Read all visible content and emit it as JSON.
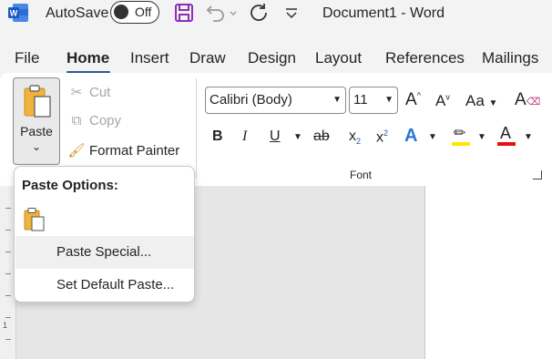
{
  "titlebar": {
    "autosave_label": "AutoSave",
    "autosave_state": "Off",
    "document_title": "Document1  -  Word"
  },
  "tabs": [
    "File",
    "Home",
    "Insert",
    "Draw",
    "Design",
    "Layout",
    "References",
    "Mailings"
  ],
  "active_tab": "Home",
  "clipboard": {
    "paste_label": "Paste",
    "cut_label": "Cut",
    "copy_label": "Copy",
    "format_painter_label": "Format Painter"
  },
  "font": {
    "family": "Calibri (Body)",
    "size": "11",
    "group_label": "Font",
    "bold": "B",
    "italic": "I",
    "underline": "U",
    "strike": "ab",
    "subscript": "x",
    "superscript": "x",
    "case": "Aa",
    "grow": "A",
    "shrink": "A",
    "effects": "A",
    "font_color": "A",
    "highlight_color": "#ffe600",
    "font_color_value": "#e3120b"
  },
  "paste_menu": {
    "heading": "Paste Options:",
    "items": [
      "Paste Special...",
      "Set Default Paste..."
    ]
  },
  "colors": {
    "accent": "#2b579a",
    "word_blue": "#185abd",
    "save_purple": "#8f2db5"
  },
  "ruler": {
    "label": "1"
  }
}
